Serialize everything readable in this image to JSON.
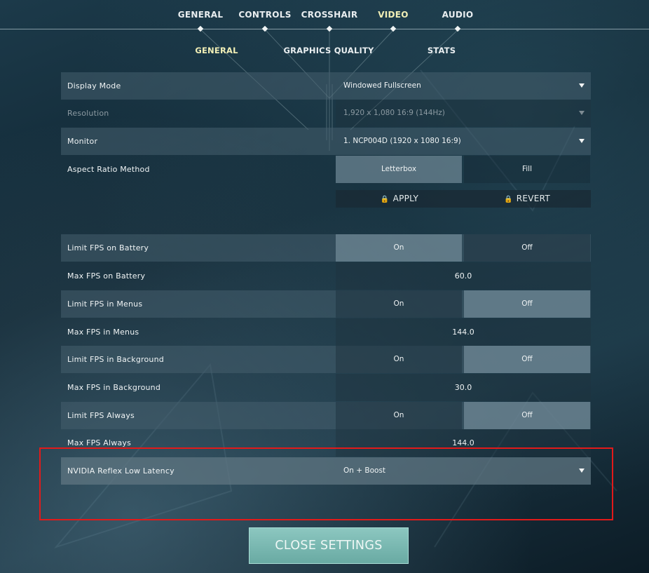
{
  "nav": {
    "tabs": [
      {
        "label": "GENERAL"
      },
      {
        "label": "CONTROLS"
      },
      {
        "label": "CROSSHAIR"
      },
      {
        "label": "VIDEO"
      },
      {
        "label": "AUDIO"
      }
    ],
    "active_tab": "VIDEO",
    "subtabs": [
      {
        "label": "GENERAL"
      },
      {
        "label": "GRAPHICS QUALITY"
      },
      {
        "label": "STATS"
      }
    ],
    "active_subtab": "GENERAL"
  },
  "display": {
    "display_mode": {
      "label": "Display Mode",
      "value": "Windowed Fullscreen"
    },
    "resolution": {
      "label": "Resolution",
      "value": "1,920 x 1,080 16:9 (144Hz)",
      "disabled": true
    },
    "monitor": {
      "label": "Monitor",
      "value": "1. NCP004D (1920 x  1080 16:9)"
    },
    "aspect_ratio": {
      "label": "Aspect Ratio Method",
      "options": [
        "Letterbox",
        "Fill"
      ],
      "selected": "Letterbox"
    },
    "apply_label": "APPLY",
    "revert_label": "REVERT"
  },
  "fps": {
    "limit_battery": {
      "label": "Limit FPS on Battery",
      "options": [
        "On",
        "Off"
      ],
      "selected": "On"
    },
    "max_battery": {
      "label": "Max FPS on Battery",
      "value": "60.0"
    },
    "limit_menus": {
      "label": "Limit FPS in Menus",
      "options": [
        "On",
        "Off"
      ],
      "selected": "Off"
    },
    "max_menus": {
      "label": "Max FPS in Menus",
      "value": "144.0"
    },
    "limit_background": {
      "label": "Limit FPS in Background",
      "options": [
        "On",
        "Off"
      ],
      "selected": "Off"
    },
    "max_background": {
      "label": "Max FPS in Background",
      "value": "30.0"
    },
    "limit_always": {
      "label": "Limit FPS Always",
      "options": [
        "On",
        "Off"
      ],
      "selected": "Off"
    },
    "max_always": {
      "label": "Max FPS Always",
      "value": "144.0"
    }
  },
  "reflex": {
    "label": "NVIDIA Reflex Low Latency",
    "value": "On + Boost"
  },
  "close_button": {
    "label": "CLOSE SETTINGS"
  },
  "colors": {
    "active_tab": "#f1efb6",
    "highlight": "#e21a1a",
    "close_button": "#7bb9b2"
  },
  "icons": {
    "lock": "lock-icon",
    "caret": "caret-down-icon",
    "nav_marker": "diamond-icon"
  }
}
